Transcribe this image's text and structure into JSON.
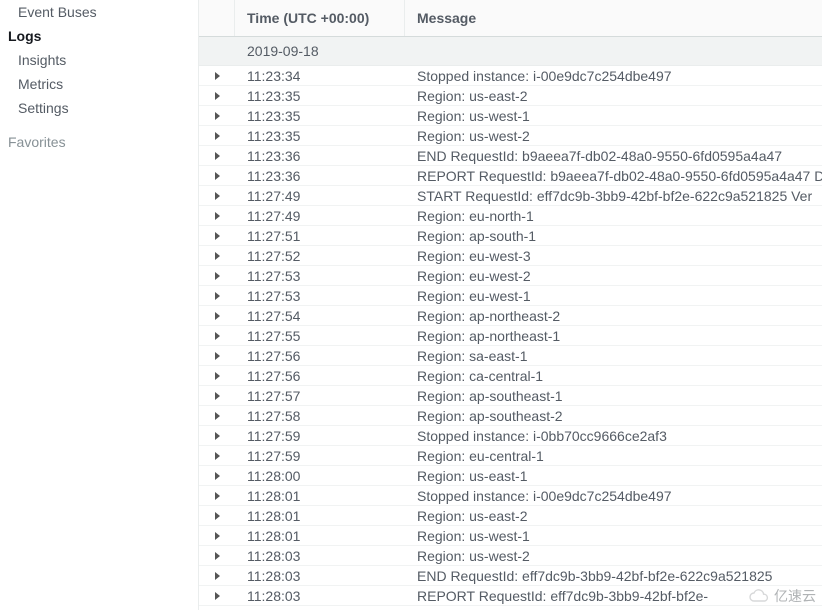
{
  "sidebar": {
    "items": [
      {
        "label": "Event Buses",
        "kind": "nav"
      },
      {
        "label": "Logs",
        "kind": "selected"
      },
      {
        "label": "Insights",
        "kind": "sub"
      },
      {
        "label": "Metrics",
        "kind": "nav"
      },
      {
        "label": "Settings",
        "kind": "nav"
      },
      {
        "label": "Favorites",
        "kind": "group"
      }
    ]
  },
  "columns": {
    "time": "Time (UTC +00:00)",
    "message": "Message"
  },
  "date_header": "2019-09-18",
  "logs": [
    {
      "time": "11:23:34",
      "msg": "Stopped instance: i-00e9dc7c254dbe497"
    },
    {
      "time": "11:23:35",
      "msg": "Region: us-east-2"
    },
    {
      "time": "11:23:35",
      "msg": "Region: us-west-1"
    },
    {
      "time": "11:23:35",
      "msg": "Region: us-west-2"
    },
    {
      "time": "11:23:36",
      "msg": "END RequestId: b9aeea7f-db02-48a0-9550-6fd0595a4a47"
    },
    {
      "time": "11:23:36",
      "msg": "REPORT RequestId: b9aeea7f-db02-48a0-9550-6fd0595a4a47 D"
    },
    {
      "time": "11:27:49",
      "msg": "START RequestId: eff7dc9b-3bb9-42bf-bf2e-622c9a521825 Ver"
    },
    {
      "time": "11:27:49",
      "msg": "Region: eu-north-1"
    },
    {
      "time": "11:27:51",
      "msg": "Region: ap-south-1"
    },
    {
      "time": "11:27:52",
      "msg": "Region: eu-west-3"
    },
    {
      "time": "11:27:53",
      "msg": "Region: eu-west-2"
    },
    {
      "time": "11:27:53",
      "msg": "Region: eu-west-1"
    },
    {
      "time": "11:27:54",
      "msg": "Region: ap-northeast-2"
    },
    {
      "time": "11:27:55",
      "msg": "Region: ap-northeast-1"
    },
    {
      "time": "11:27:56",
      "msg": "Region: sa-east-1"
    },
    {
      "time": "11:27:56",
      "msg": "Region: ca-central-1"
    },
    {
      "time": "11:27:57",
      "msg": "Region: ap-southeast-1"
    },
    {
      "time": "11:27:58",
      "msg": "Region: ap-southeast-2"
    },
    {
      "time": "11:27:59",
      "msg": "Stopped instance: i-0bb70cc9666ce2af3"
    },
    {
      "time": "11:27:59",
      "msg": "Region: eu-central-1"
    },
    {
      "time": "11:28:00",
      "msg": "Region: us-east-1"
    },
    {
      "time": "11:28:01",
      "msg": "Stopped instance: i-00e9dc7c254dbe497"
    },
    {
      "time": "11:28:01",
      "msg": "Region: us-east-2"
    },
    {
      "time": "11:28:01",
      "msg": "Region: us-west-1"
    },
    {
      "time": "11:28:03",
      "msg": "Region: us-west-2"
    },
    {
      "time": "11:28:03",
      "msg": "END RequestId: eff7dc9b-3bb9-42bf-bf2e-622c9a521825"
    },
    {
      "time": "11:28:03",
      "msg": "REPORT RequestId: eff7dc9b-3bb9-42bf-bf2e-"
    }
  ],
  "watermark": "亿速云"
}
